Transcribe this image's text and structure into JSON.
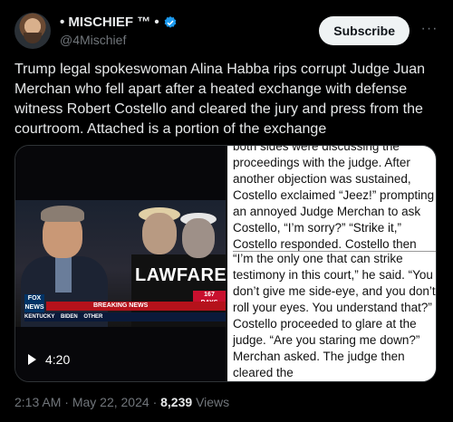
{
  "author": {
    "display_name": "• MISCHIEF ™ •",
    "handle": "@4Mischief"
  },
  "actions": {
    "subscribe_label": "Subscribe",
    "more_label": "···"
  },
  "tweet": {
    "text": "Trump legal spokeswoman Alina Habba rips corrupt Judge Juan Merchan who fell apart after a heated exchange with defense witness Robert Costello and cleared the jury and press from the courtroom. Attached is a portion of the exchange"
  },
  "video": {
    "duration": "4:20",
    "overlay_text": "LAWFARE",
    "days_count": "167",
    "days_label": "DAYS",
    "network_logo": "FOX NEWS",
    "breaking_label": "BREAKING NEWS",
    "ticker": [
      "KENTUCKY",
      "BIDEN",
      "OTHER"
    ]
  },
  "document": {
    "part_a": "both sides were discussing the proceedings with the judge. After another objection was sustained, Costello exclaimed “Jeez!” prompting an annoyed Judge Merchan to ask Costello, “I’m sorry?” “Strike it,” Costello responded. Costello then rolled his eyes and",
    "part_b": "“I’m the only one that can strike testimony in this court,” he said. “You don’t give me side-eye, and you don’t roll your eyes. You understand that?” Costello proceeded to glare at the judge. “Are you staring me down?” Merchan asked. The judge then cleared the"
  },
  "meta": {
    "time": "2:13 AM",
    "date": "May 22, 2024",
    "separator": "·",
    "views_count": "8,239",
    "views_label": "Views"
  },
  "colors": {
    "background": "#000000",
    "text": "#e7e9ea",
    "muted": "#71767b",
    "verified": "#1d9bf0"
  }
}
